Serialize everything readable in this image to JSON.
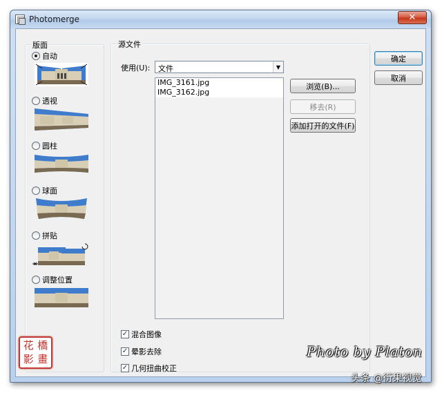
{
  "window": {
    "title": "Photomerge",
    "close_glyph": "✕"
  },
  "layout": {
    "legend": "版面",
    "options": [
      {
        "label": "自动",
        "checked": true
      },
      {
        "label": "透视",
        "checked": false
      },
      {
        "label": "圆柱",
        "checked": false
      },
      {
        "label": "球面",
        "checked": false
      },
      {
        "label": "拼贴",
        "checked": false
      },
      {
        "label": "调整位置",
        "checked": false
      }
    ]
  },
  "source": {
    "legend": "源文件",
    "use_label": "使用(U):",
    "use_value": "文件",
    "files": [
      "IMG_3161.jpg",
      "IMG_3162.jpg"
    ],
    "browse_button": "浏览(B)...",
    "remove_button": "移去(R)",
    "add_open_button": "添加打开的文件(F)",
    "checkboxes": [
      {
        "label": "混合图像",
        "checked": true
      },
      {
        "label": "晕影去除",
        "checked": true
      },
      {
        "label": "几何扭曲校正",
        "checked": true
      }
    ]
  },
  "actions": {
    "ok": "确定",
    "cancel": "取消"
  },
  "watermarks": {
    "seal_chars": [
      "花",
      "橋",
      "影",
      "畫"
    ],
    "photo_credit": "Photo by Platon",
    "site_credit": "头条 @衍果视觉"
  },
  "colors": {
    "sky": "#3c78c7",
    "building": "#d7cfb7",
    "ground": "#7b6a52",
    "seal_red": "#c23a36"
  },
  "icons": [
    "app-icon",
    "close-icon",
    "dropdown-arrow-icon",
    "check-icon",
    "rotate-icon",
    "move-icon"
  ]
}
